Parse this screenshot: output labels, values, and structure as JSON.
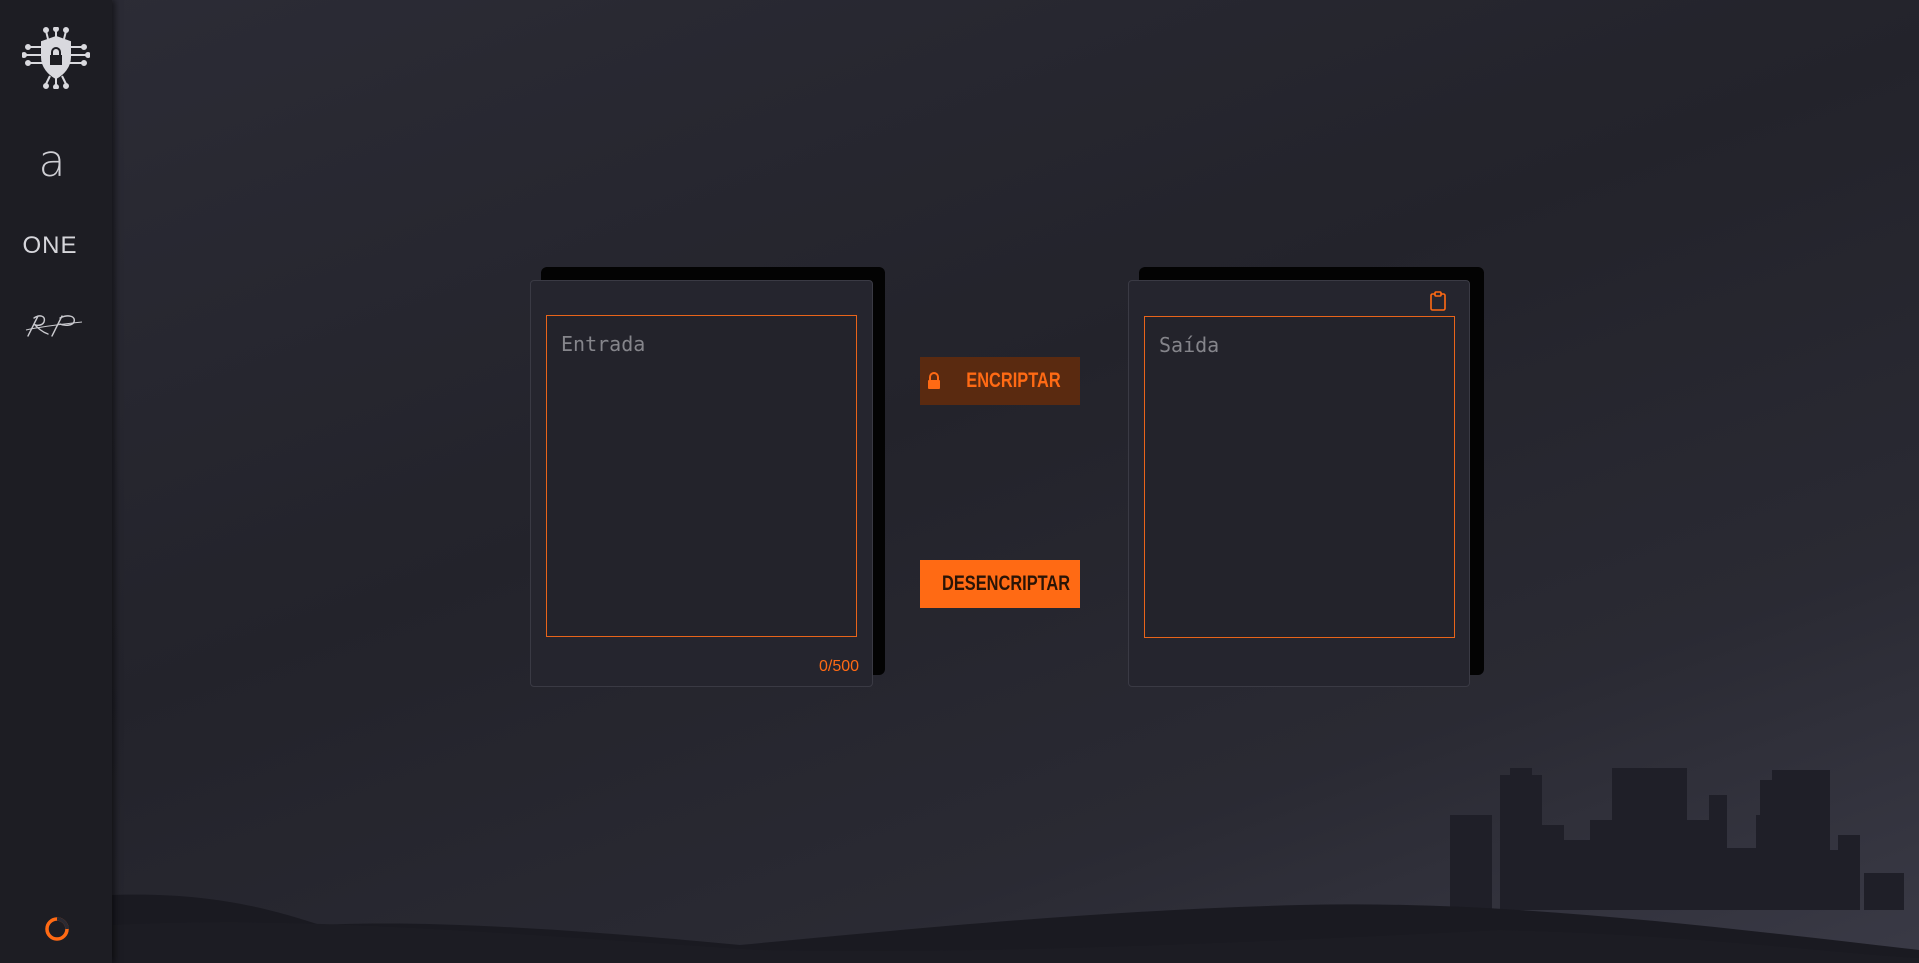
{
  "sidebar": {
    "brand_letter": "a",
    "brand_name": "ONE",
    "signature": "RP",
    "logo_icon": "shield-lock-circuit-icon",
    "loader_icon": "loading-ring-icon"
  },
  "encrypt_panel": {
    "input_placeholder": "Entrada",
    "input_value": "",
    "char_counter": "0/500"
  },
  "actions": {
    "encrypt_label": "ENCRIPTAR",
    "encrypt_icon": "lock-closed-icon",
    "decrypt_label": "DESENCRIPTAR",
    "decrypt_icon": "lock-open-icon"
  },
  "output_panel": {
    "output_placeholder": "Saída",
    "output_value": "",
    "copy_icon": "clipboard-icon"
  },
  "colors": {
    "accent": "#ff6a14",
    "accent_dark": "#5a2a10",
    "sidebar_bg": "#1d1d23",
    "card_bg": "#25252e"
  }
}
